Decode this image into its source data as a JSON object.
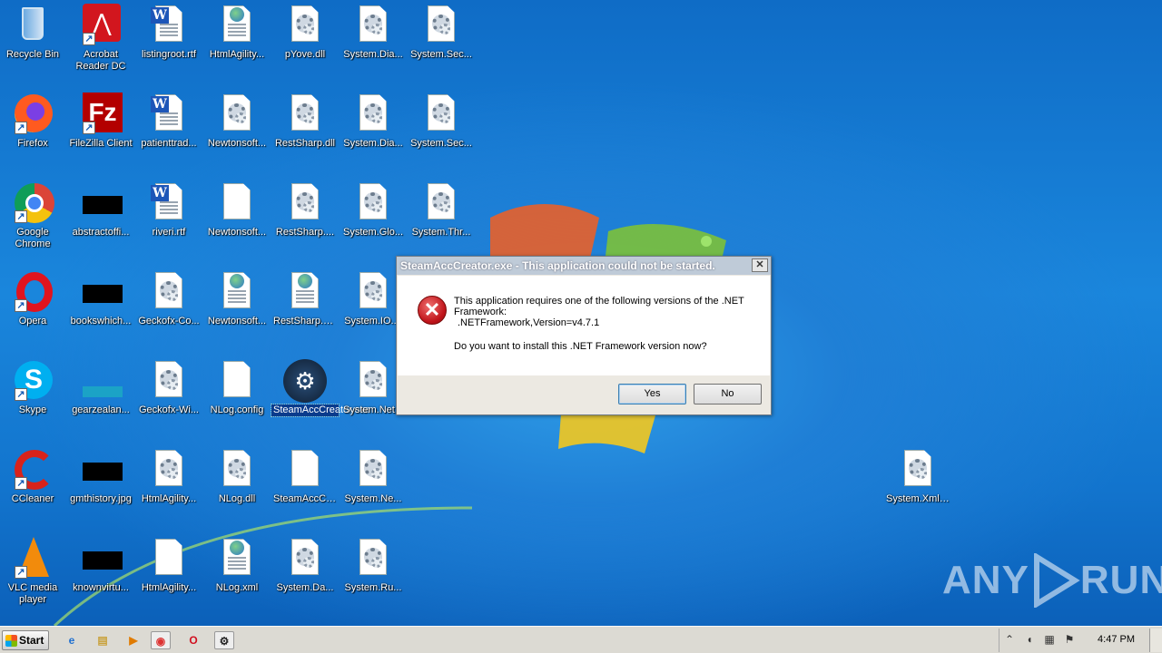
{
  "desktop": {
    "icons": [
      {
        "label": "Recycle Bin",
        "type": "recycle"
      },
      {
        "label": "Acrobat Reader DC",
        "type": "acrobat"
      },
      {
        "label": "listingroot.rtf",
        "type": "word"
      },
      {
        "label": "HtmlAgility...",
        "type": "web"
      },
      {
        "label": "pYove.dll",
        "type": "gear"
      },
      {
        "label": "System.Dia...",
        "type": "gear"
      },
      {
        "label": "System.Sec...",
        "type": "gear"
      },
      {
        "label": "Firefox",
        "type": "firefox"
      },
      {
        "label": "FileZilla Client",
        "type": "filezilla"
      },
      {
        "label": "patienttrad...",
        "type": "word"
      },
      {
        "label": "Newtonsoft...",
        "type": "gear"
      },
      {
        "label": "RestSharp.dll",
        "type": "gear"
      },
      {
        "label": "System.Dia...",
        "type": "gear"
      },
      {
        "label": "System.Sec...",
        "type": "gear"
      },
      {
        "label": "Google Chrome",
        "type": "chrome"
      },
      {
        "label": "abstractoffi...",
        "type": "black"
      },
      {
        "label": "riveri.rtf",
        "type": "word"
      },
      {
        "label": "Newtonsoft...",
        "type": "blank"
      },
      {
        "label": "RestSharp....",
        "type": "gear"
      },
      {
        "label": "System.Glo...",
        "type": "gear"
      },
      {
        "label": "System.Thr...",
        "type": "gear"
      },
      {
        "label": "Opera",
        "type": "opera"
      },
      {
        "label": "bookswhich...",
        "type": "black"
      },
      {
        "label": "Geckofx-Co...",
        "type": "gear"
      },
      {
        "label": "Newtonsoft...",
        "type": "web"
      },
      {
        "label": "RestSharp.xml",
        "type": "web"
      },
      {
        "label": "System.IO....",
        "type": "gear"
      },
      {
        "label": "Skype",
        "type": "skype"
      },
      {
        "label": "gearzealan...",
        "type": "teal"
      },
      {
        "label": "Geckofx-Wi...",
        "type": "gear"
      },
      {
        "label": "NLog.config",
        "type": "blank"
      },
      {
        "label": "SteamAccCreator.exe",
        "type": "steam"
      },
      {
        "label": "System.Net...",
        "type": "gear"
      },
      {
        "label": "CCleaner",
        "type": "ccleaner"
      },
      {
        "label": "gmthistory.jpg",
        "type": "black"
      },
      {
        "label": "HtmlAgility...",
        "type": "gear"
      },
      {
        "label": "NLog.dll",
        "type": "gear"
      },
      {
        "label": "SteamAccCr...",
        "type": "blank"
      },
      {
        "label": "System.Ne...",
        "type": "gear"
      },
      {
        "label": "System.Xml....",
        "type": "gear"
      },
      {
        "label": "VLC media player",
        "type": "vlc"
      },
      {
        "label": "knownvirtu...",
        "type": "black"
      },
      {
        "label": "HtmlAgility...",
        "type": "blank"
      },
      {
        "label": "NLog.xml",
        "type": "web"
      },
      {
        "label": "System.Da...",
        "type": "gear"
      },
      {
        "label": "System.Ru...",
        "type": "gear"
      }
    ]
  },
  "dialog": {
    "title": "SteamAccCreator.exe - This application could not be started.",
    "close": "✕",
    "line1": "This application requires one of the following versions of the .NET Framework:",
    "line2": ".NETFramework,Version=v4.7.1",
    "line3": "Do you want to install this .NET Framework version now?",
    "yes": "Yes",
    "no": "No"
  },
  "taskbar": {
    "start": "Start",
    "clock": "4:47 PM"
  },
  "watermark": {
    "text1": "ANY",
    "text2": "RUN"
  }
}
